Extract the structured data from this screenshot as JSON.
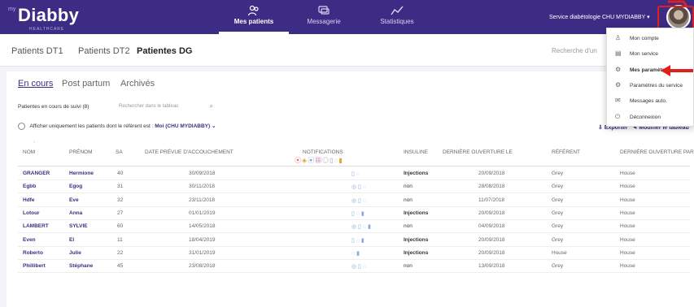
{
  "app": {
    "logo_prefix": "my",
    "logo_name": "Diabby",
    "logo_sub": "HEALTHCARE"
  },
  "nav": [
    {
      "label": "Mes patients",
      "icon": "patients-icon",
      "active": true
    },
    {
      "label": "Messagerie",
      "icon": "messages-icon",
      "active": false
    },
    {
      "label": "Statistiques",
      "icon": "stats-icon",
      "active": false
    }
  ],
  "service_select": "Service diabétologie CHU MYDIABBY ▾",
  "subtabs": [
    "Patients DT1",
    "Patients DT2",
    "Patientes DG"
  ],
  "search_top_placeholder": "Recherche d'un",
  "tabs": [
    "En cours",
    "Post partum",
    "Archivés"
  ],
  "count_label": "Patientes en cours de suivi (8)",
  "table_search_placeholder": "Rechercher dans le tableau",
  "filter": {
    "label": "Afficher uniquement les patients dont le référent est :",
    "value": "Moi (CHU MYDIABBY)"
  },
  "actions": {
    "export": "Exporter",
    "modify": "Modifier le tableau"
  },
  "columns": [
    "NOM",
    "PRÉNOM",
    "SA",
    "DATE PRÉVUE D'ACCOUCHEMENT",
    "NOTIFICATIONS",
    "INSULINE",
    "DERNIÈRE OUVERTURE LE",
    "RÉFÉRENT",
    "DERNIÈRE OUVERTURE PAR"
  ],
  "rows": [
    {
      "nom": "GRANGER",
      "prenom": "Hermione",
      "sa": "40",
      "date": "30/09/2018",
      "notif": "▯ ◌",
      "insuline": "Injections",
      "derniere": "20/09/2018",
      "referent": "Grey",
      "par": "House"
    },
    {
      "nom": "Egbb",
      "prenom": "Egog",
      "sa": "31",
      "date": "30/11/2018",
      "notif": "◎ ▯ ◌",
      "insuline": "non",
      "derniere": "28/08/2018",
      "referent": "Grey",
      "par": "House"
    },
    {
      "nom": "Hdfe",
      "prenom": "Eve",
      "sa": "32",
      "date": "23/11/2018",
      "notif": "◎ ▯ ◌",
      "insuline": "non",
      "derniere": "11/07/2018",
      "referent": "Grey",
      "par": "House"
    },
    {
      "nom": "Lotour",
      "prenom": "Anna",
      "sa": "27",
      "date": "01/01/2019",
      "notif": "▯ ◌ ▮",
      "insuline": "Injections",
      "derniere": "20/09/2018",
      "referent": "Grey",
      "par": "House"
    },
    {
      "nom": "LAMBERT",
      "prenom": "SYLVIE",
      "sa": "60",
      "date": "14/05/2018",
      "notif": "◎ ▯ ◌ ▮",
      "insuline": "non",
      "derniere": "04/09/2018",
      "referent": "Grey",
      "par": "House"
    },
    {
      "nom": "Even",
      "prenom": "El",
      "sa": "11",
      "date": "18/04/2019",
      "notif": "▯ ◌ ▮",
      "insuline": "Injections",
      "derniere": "20/09/2018",
      "referent": "Grey",
      "par": "House"
    },
    {
      "nom": "Roberto",
      "prenom": "Julie",
      "sa": "22",
      "date": "31/01/2019",
      "notif": "◌ ▮",
      "insuline": "Injections",
      "derniere": "20/09/2018",
      "referent": "House",
      "par": "House"
    },
    {
      "nom": "Phillibert",
      "prenom": "Stéphane",
      "sa": "45",
      "date": "23/08/2018",
      "notif": "◎ ▯ ◌",
      "insuline": "non",
      "derniere": "13/09/2018",
      "referent": "Grey",
      "par": "House"
    }
  ],
  "dropdown": [
    {
      "label": "Mon compte",
      "icon": "user-icon"
    },
    {
      "label": "Mon service",
      "icon": "hospital-icon"
    },
    {
      "label": "Mes paramètres",
      "icon": "settings-icon"
    },
    {
      "label": "Paramètres du service",
      "icon": "service-settings-icon"
    },
    {
      "label": "Messages auto.",
      "icon": "mail-icon"
    },
    {
      "label": "Déconnexion",
      "icon": "power-icon"
    }
  ],
  "colors": {
    "brand": "#3d2c84",
    "highlight": "#e0201b"
  }
}
